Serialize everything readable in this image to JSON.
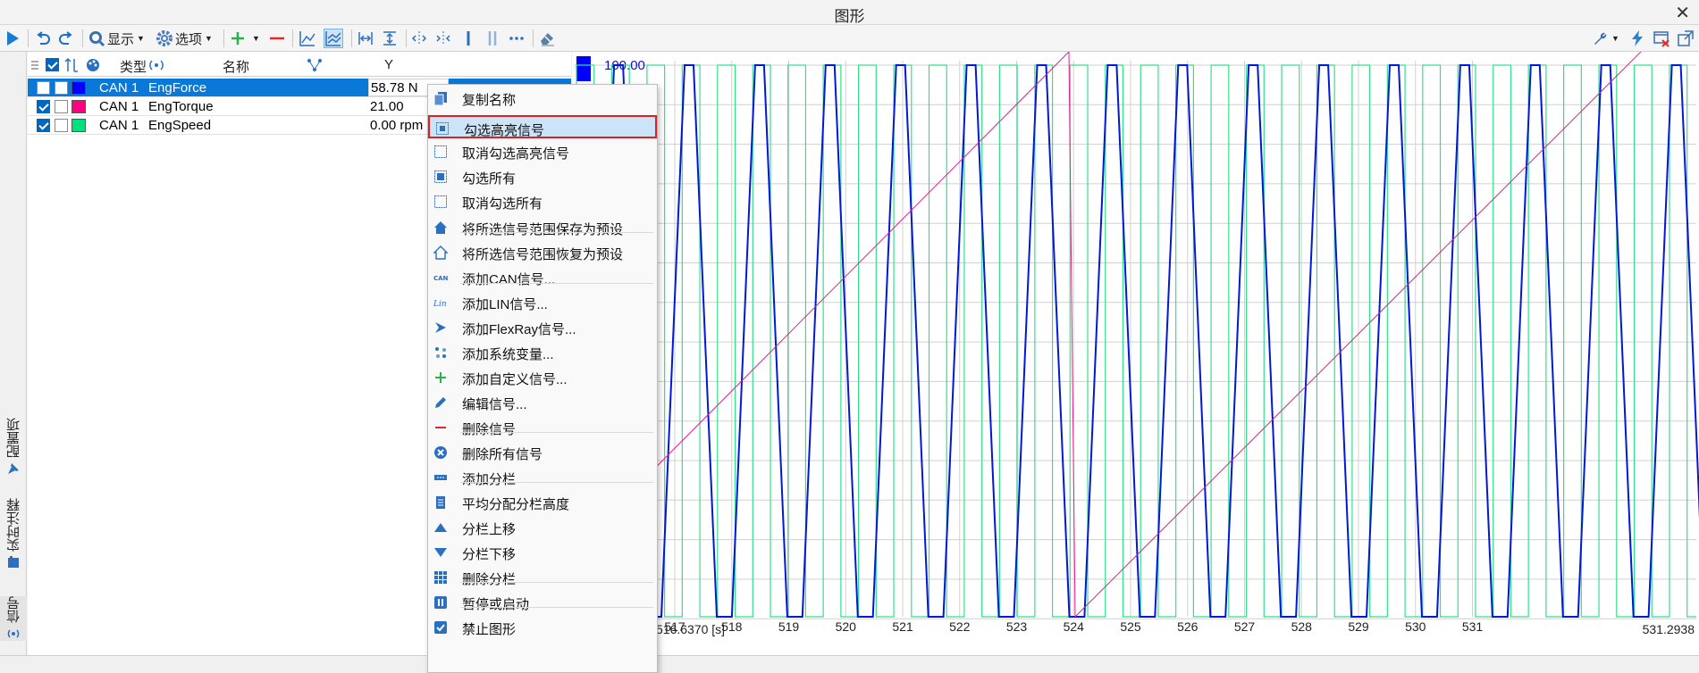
{
  "window": {
    "title": "图形"
  },
  "toolbar": {
    "display_label": "显示",
    "options_label": "选项"
  },
  "left_tabs": {
    "config": "配置项",
    "annotation": "实时注释",
    "signal": "信号"
  },
  "signal_grid": {
    "headers": {
      "type": "类型",
      "name": "名称",
      "y": "Y"
    },
    "rows": [
      {
        "checked": false,
        "color": "#0000ff",
        "type": "CAN 1",
        "name": "EngForce",
        "value": "58.78 N",
        "selected": true
      },
      {
        "checked": true,
        "color": "#ff0080",
        "type": "CAN 1",
        "name": "EngTorque",
        "value": "21.00",
        "selected": false
      },
      {
        "checked": true,
        "color": "#00e080",
        "type": "CAN 1",
        "name": "EngSpeed",
        "value": "0.00 rpm",
        "selected": false
      }
    ]
  },
  "plot": {
    "y_max_label": "100.00",
    "x_ticks": [
      "517",
      "518",
      "519",
      "520",
      "521",
      "522",
      "523",
      "524",
      "525",
      "526",
      "527",
      "528",
      "529",
      "530",
      "531"
    ],
    "x_start_label": "516.6370 [s]",
    "x_end_label": "531.2938",
    "colors": {
      "force": "#0018d8",
      "torque": "#e0208c",
      "speed": "#33e08a"
    }
  },
  "context_menu": {
    "items": [
      {
        "label": "复制名称",
        "icon": "copy-icon"
      },
      {
        "label": "勾选高亮信号",
        "icon": "check-highlight-icon",
        "highlighted": true
      },
      {
        "label": "取消勾选高亮信号",
        "icon": "uncheck-highlight-icon"
      },
      {
        "label": "勾选所有",
        "icon": "check-all-icon"
      },
      {
        "label": "取消勾选所有",
        "icon": "uncheck-all-icon"
      },
      {
        "label": "将所选信号范围保存为预设",
        "icon": "home-save-icon"
      },
      {
        "label": "将所选信号范围恢复为预设",
        "icon": "home-restore-icon"
      },
      {
        "label": "添加CAN信号...",
        "icon": "can-icon"
      },
      {
        "label": "添加LIN信号...",
        "icon": "lin-icon"
      },
      {
        "label": "添加FlexRay信号...",
        "icon": "flexray-icon"
      },
      {
        "label": "添加系统变量...",
        "icon": "system-variable-icon"
      },
      {
        "label": "添加自定义信号...",
        "icon": "plus-icon"
      },
      {
        "label": "编辑信号...",
        "icon": "pencil-icon"
      },
      {
        "label": "删除信号",
        "icon": "minus-icon"
      },
      {
        "label": "删除所有信号",
        "icon": "delete-all-icon"
      },
      {
        "label": "添加分栏",
        "icon": "add-panel-icon"
      },
      {
        "label": "平均分配分栏高度",
        "icon": "distribute-panels-icon"
      },
      {
        "label": "分栏上移",
        "icon": "move-up-icon"
      },
      {
        "label": "分栏下移",
        "icon": "move-down-icon"
      },
      {
        "label": "删除分栏",
        "icon": "delete-panel-icon"
      },
      {
        "label": "暂停或启动",
        "icon": "pause-icon"
      },
      {
        "label": "禁止图形",
        "icon": "disable-graph-icon"
      }
    ]
  }
}
